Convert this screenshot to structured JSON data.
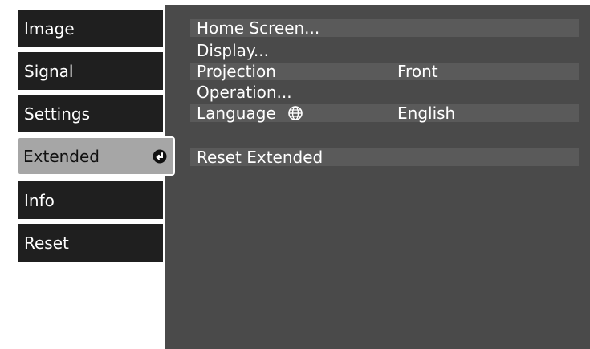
{
  "tabs": [
    {
      "label": "Image"
    },
    {
      "label": "Signal"
    },
    {
      "label": "Settings"
    },
    {
      "label": "Extended"
    },
    {
      "label": "Info"
    },
    {
      "label": "Reset"
    }
  ],
  "menu": {
    "items": [
      {
        "label": "Home Screen..."
      },
      {
        "label": "Display..."
      },
      {
        "label": "Projection",
        "value": "Front"
      },
      {
        "label": "Operation..."
      },
      {
        "label": "Language",
        "icon": "globe-icon",
        "value": "English"
      }
    ],
    "reset_label": "Reset Extended"
  },
  "colors": {
    "tab_bg": "#1f1f1f",
    "active_tab_bg": "#a6a6a6",
    "panel_bg": "#4a4a4a",
    "row_bg": "#5a5a5a"
  }
}
